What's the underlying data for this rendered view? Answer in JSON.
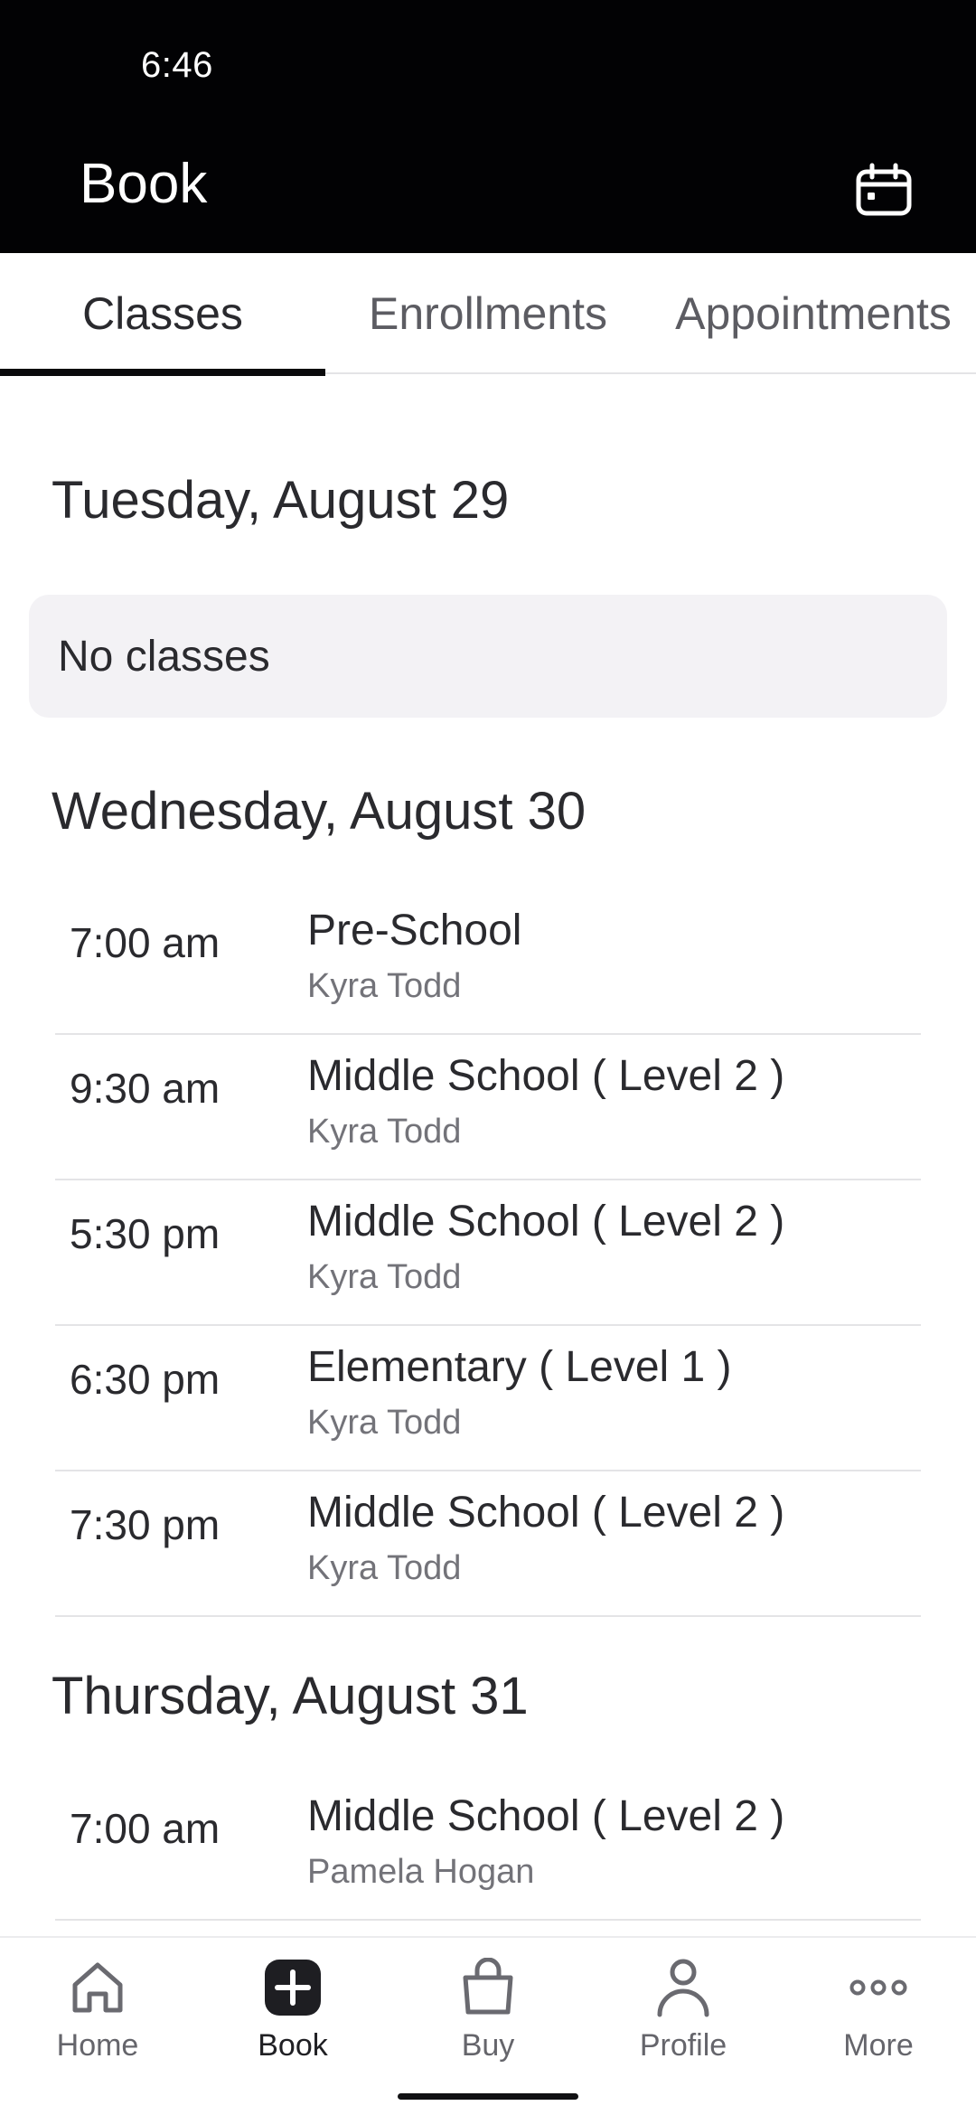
{
  "status_bar": {
    "time": "6:46"
  },
  "app_bar": {
    "title": "Book",
    "calendar_icon": "calendar-icon"
  },
  "tabs": [
    {
      "label": "Classes",
      "active": true
    },
    {
      "label": "Enrollments",
      "active": false
    },
    {
      "label": "Appointments",
      "active": false
    }
  ],
  "days": [
    {
      "heading": "Tuesday, August 29",
      "empty_message": "No classes",
      "classes": []
    },
    {
      "heading": "Wednesday, August 30",
      "classes": [
        {
          "time": "7:00 am",
          "name": "Pre-School",
          "instructor": "Kyra Todd"
        },
        {
          "time": "9:30 am",
          "name": "Middle School ( Level 2 )",
          "instructor": "Kyra Todd"
        },
        {
          "time": "5:30 pm",
          "name": "Middle School ( Level 2 )",
          "instructor": "Kyra Todd"
        },
        {
          "time": "6:30 pm",
          "name": "Elementary ( Level 1 )",
          "instructor": "Kyra Todd"
        },
        {
          "time": "7:30 pm",
          "name": "Middle School ( Level 2 )",
          "instructor": "Kyra Todd"
        }
      ]
    },
    {
      "heading": "Thursday, August 31",
      "classes": [
        {
          "time": "7:00 am",
          "name": "Middle School ( Level 2 )",
          "instructor": "Pamela Hogan"
        }
      ]
    }
  ],
  "bottom_nav": [
    {
      "label": "Home",
      "icon": "home-icon",
      "active": false
    },
    {
      "label": "Book",
      "icon": "plus-square-icon",
      "active": true
    },
    {
      "label": "Buy",
      "icon": "shopping-bag-icon",
      "active": false
    },
    {
      "label": "Profile",
      "icon": "person-icon",
      "active": false
    },
    {
      "label": "More",
      "icon": "more-dots-icon",
      "active": false
    }
  ],
  "colors": {
    "header_bg": "#020204",
    "text_primary": "#2a2a2e",
    "text_secondary": "#737379",
    "card_bg": "#f3f2f5",
    "tab_indicator": "#0a0a0c"
  }
}
